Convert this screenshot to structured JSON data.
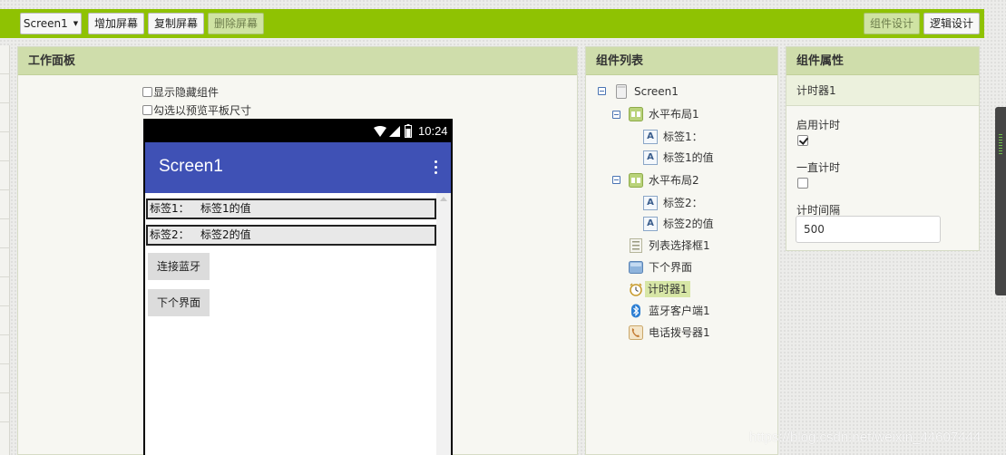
{
  "toolbar": {
    "screen_select": "Screen1",
    "add_screen": "增加屏幕",
    "copy_screen": "复制屏幕",
    "delete_screen": "删除屏幕",
    "designer": "组件设计",
    "blocks": "逻辑设计"
  },
  "workspace": {
    "title": "工作面板",
    "show_hidden": "显示隐藏组件",
    "tablet_preview": "勾选以预览平板尺寸",
    "phone": {
      "time": "10:24",
      "screen_title": "Screen1",
      "row1": {
        "label": "标签1：",
        "value": "标签1的值"
      },
      "row2": {
        "label": "标签2：",
        "value": "标签2的值"
      },
      "button_connect": "连接蓝牙",
      "button_next": "下个界面"
    }
  },
  "components": {
    "title": "组件列表",
    "tree": {
      "screen": "Screen1",
      "h1": "水平布局1",
      "h1_label1": "标签1：",
      "h1_label2": "标签1的值",
      "h2": "水平布局2",
      "h2_label1": "标签2：",
      "h2_label2": "标签2的值",
      "listpicker": "列表选择框1",
      "next": "下个界面",
      "timer": "计时器1",
      "bt": "蓝牙客户端1",
      "phone": "电话拨号器1"
    }
  },
  "properties": {
    "title": "组件属性",
    "component": "计时器1",
    "enabled_label": "启用计时",
    "enabled": true,
    "always_label": "一直计时",
    "always": false,
    "interval_label": "计时间隔",
    "interval": "500"
  },
  "watermark": "https://blog.csdn.net/weixin_44607444",
  "colors": {
    "toolbar": "#8fc202",
    "panel_header": "#cfddab",
    "appbar": "#3f51b5",
    "selected": "#d7e6a6"
  }
}
